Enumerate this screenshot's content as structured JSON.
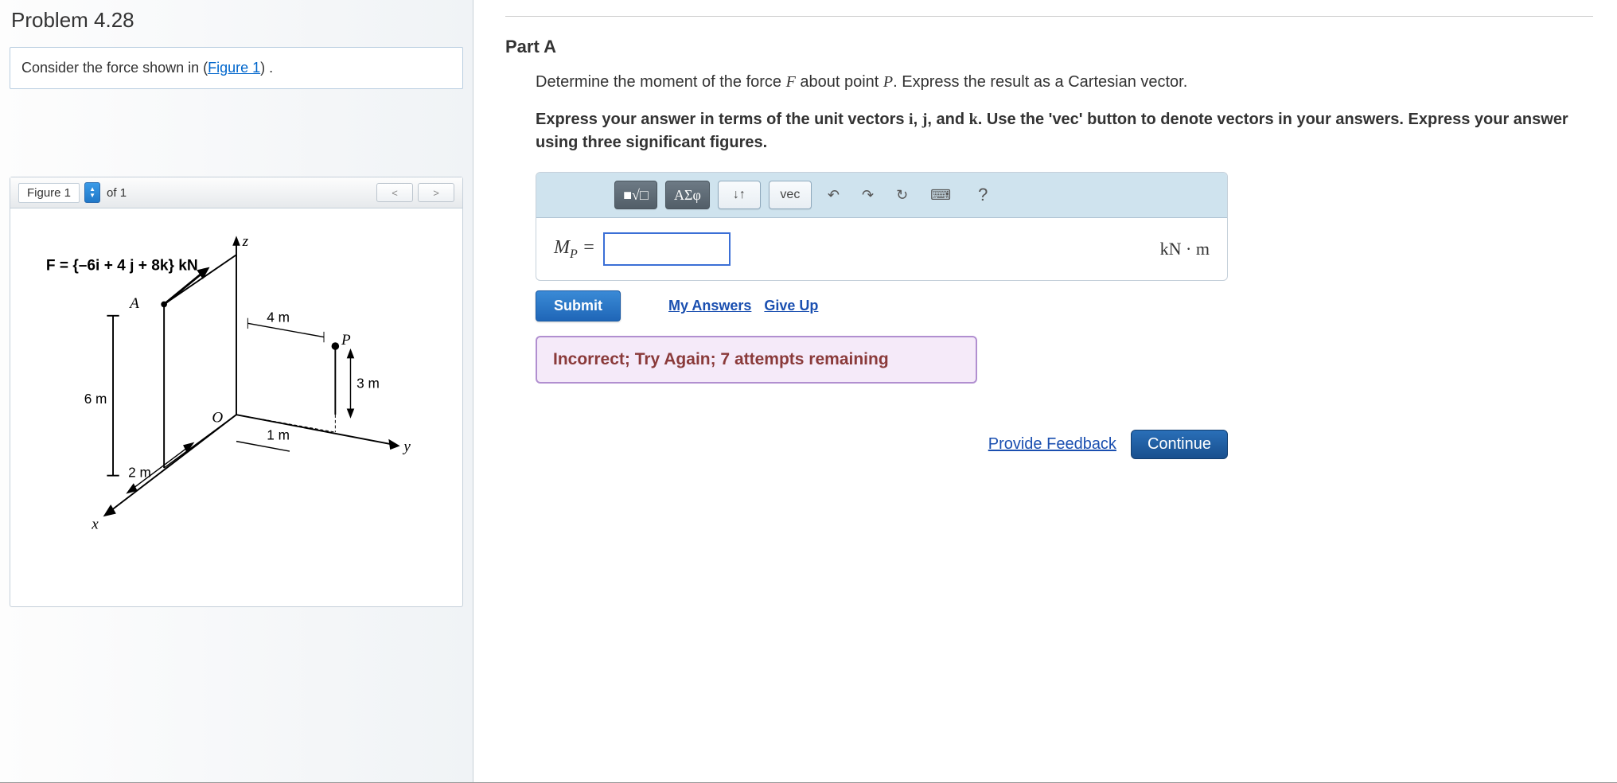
{
  "problem": {
    "title": "Problem 4.28",
    "statement_prefix": "Consider the force shown in (",
    "figure_link_text": "Figure 1",
    "statement_suffix": ") ."
  },
  "figure": {
    "selector_label": "Figure 1",
    "of_text": "of 1",
    "force_label": "F = {–6i + 4 j + 8k} kN",
    "axis_z": "z",
    "axis_y": "y",
    "axis_x": "x",
    "pt_A": "A",
    "pt_P": "P",
    "pt_O": "O",
    "dim_4m": "4 m",
    "dim_3m": "3 m",
    "dim_6m": "6 m",
    "dim_1m": "1 m",
    "dim_2m": "2 m"
  },
  "part": {
    "label": "Part A",
    "prompt_1": "Determine the moment of the force ",
    "prompt_F": "F",
    "prompt_2": " about point ",
    "prompt_P": "P",
    "prompt_3": ". Express the result as a Cartesian vector.",
    "instruct_1": "Express your answer in terms of the unit vectors ",
    "uv_i": "i",
    "uv_comma1": ", ",
    "uv_j": "j",
    "uv_comma2": ", and ",
    "uv_k": "k",
    "instruct_2": ". Use the 'vec' button to denote vectors in your answers. Express your answer using three significant figures."
  },
  "answer": {
    "toolbar": {
      "templates": "■√□",
      "greek": "ΑΣφ",
      "subscript": "↓↑",
      "vec": "vec",
      "undo": "↶",
      "redo": "↷",
      "reset": "↻",
      "keyboard": "⌨",
      "help": "?"
    },
    "var_label_base": "M",
    "var_label_sub": "P",
    "equals": " = ",
    "value": "",
    "unit": "kN · m"
  },
  "actions": {
    "submit": "Submit",
    "my_answers": "My Answers",
    "give_up": "Give Up"
  },
  "feedback": {
    "message": "Incorrect; Try Again; 7 attempts remaining"
  },
  "footer": {
    "provide_feedback": "Provide Feedback",
    "continue": "Continue"
  }
}
